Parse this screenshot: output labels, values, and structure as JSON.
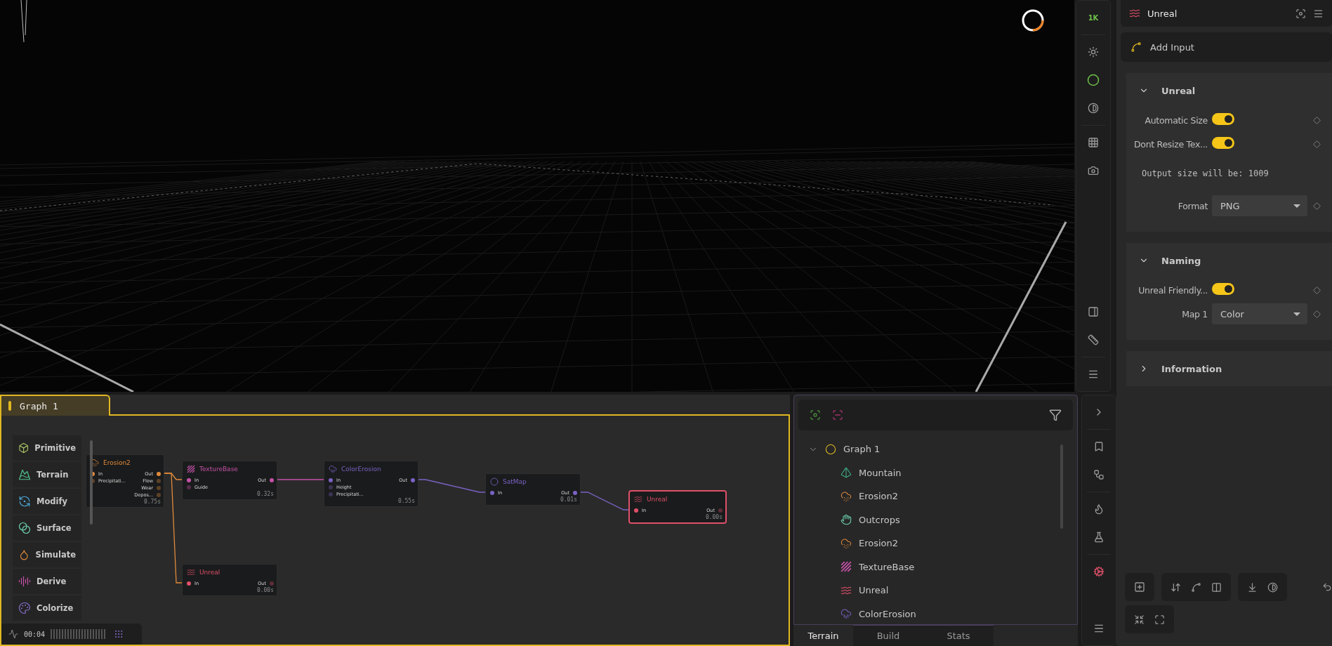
{
  "viewport": {
    "resolution_badge": "1K"
  },
  "graph": {
    "tab": {
      "label": "Graph 1",
      "selected": true
    },
    "palette": [
      {
        "label": "Primitive",
        "kind": "primitive"
      },
      {
        "label": "Terrain",
        "kind": "terrain"
      },
      {
        "label": "Modify",
        "kind": "modify"
      },
      {
        "label": "Surface",
        "kind": "surface"
      },
      {
        "label": "Simulate",
        "kind": "simulate"
      },
      {
        "label": "Derive",
        "kind": "derive"
      },
      {
        "label": "Colorize",
        "kind": "colorize"
      }
    ],
    "nodes": [
      {
        "kind": "erosion",
        "title": "Erosion2",
        "inputs": [
          "In",
          "Precipitati..."
        ],
        "outputs": [
          "Out",
          "Flow",
          "Wear",
          "Depos..."
        ],
        "time": "0.75s",
        "selected": false
      },
      {
        "kind": "texture",
        "title": "TextureBase",
        "inputs": [
          "In",
          "Guide"
        ],
        "outputs": [
          "Out"
        ],
        "time": "0.32s",
        "selected": false
      },
      {
        "kind": "colorerosion",
        "title": "ColorErosion",
        "inputs": [
          "In",
          "Height",
          "Precipitati..."
        ],
        "outputs": [
          "Out"
        ],
        "time": "0.55s",
        "selected": false
      },
      {
        "kind": "satmap",
        "title": "SatMap",
        "inputs": [
          "In"
        ],
        "outputs": [
          "Out"
        ],
        "time": "0.01s",
        "selected": false
      },
      {
        "kind": "output",
        "title": "Unreal",
        "inputs": [
          "In"
        ],
        "outputs": [
          "Out"
        ],
        "time": "0.00s",
        "selected": true
      },
      {
        "kind": "output",
        "title": "Unreal",
        "inputs": [
          "In"
        ],
        "outputs": [
          "Out"
        ],
        "time": "0.00s",
        "selected": false
      }
    ],
    "status": {
      "time": "00:04"
    }
  },
  "tree": {
    "root": {
      "label": "Graph 1",
      "expanded": true,
      "children": [
        {
          "label": "Mountain",
          "kind": "mountain"
        },
        {
          "label": "Erosion2",
          "kind": "erosion"
        },
        {
          "label": "Outcrops",
          "kind": "outcrops"
        },
        {
          "label": "Erosion2",
          "kind": "erosion"
        },
        {
          "label": "TextureBase",
          "kind": "texture"
        },
        {
          "label": "Unreal",
          "kind": "output"
        },
        {
          "label": "ColorErosion",
          "kind": "colorerosion"
        }
      ]
    },
    "tabs": [
      {
        "label": "Terrain",
        "selected": true
      },
      {
        "label": "Build",
        "selected": false
      },
      {
        "label": "Stats",
        "selected": false
      }
    ]
  },
  "properties": {
    "title": "Unreal",
    "add_input": "Add Input",
    "sections": [
      {
        "title": "Unreal",
        "expanded": true,
        "rows": [
          {
            "kind": "toggle",
            "label": "Automatic Size",
            "on": true
          },
          {
            "kind": "toggle",
            "label": "Dont Resize Tex...",
            "on": true
          },
          {
            "kind": "note",
            "text": "Output size will be: 1009"
          },
          {
            "kind": "select",
            "label": "Format",
            "value": "PNG"
          }
        ]
      },
      {
        "title": "Naming",
        "expanded": true,
        "rows": [
          {
            "kind": "toggle",
            "label": "Unreal Friendly...",
            "on": true
          },
          {
            "kind": "select",
            "label": "Map 1",
            "value": "Color"
          }
        ]
      },
      {
        "title": "Information",
        "expanded": false
      }
    ]
  }
}
